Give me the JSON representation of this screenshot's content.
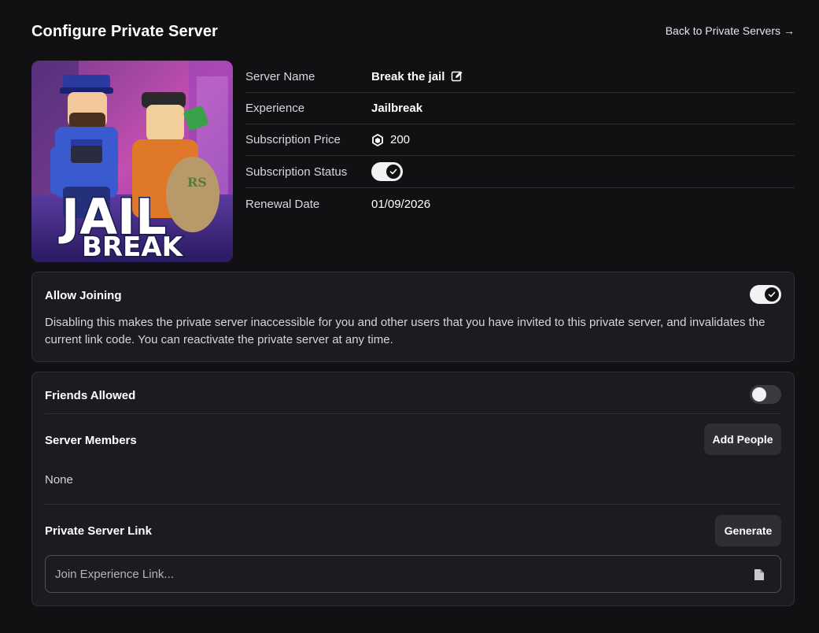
{
  "header": {
    "title": "Configure Private Server",
    "back_link": "Back to Private Servers",
    "back_arrow": "→"
  },
  "thumbnail": {
    "logo_top": "JAIL",
    "logo_bottom": "BREAK",
    "bag_text": "RS"
  },
  "details": {
    "server_name_label": "Server Name",
    "server_name_value": "Break the jail",
    "experience_label": "Experience",
    "experience_value": "Jailbreak",
    "price_label": "Subscription Price",
    "price_value": "200",
    "status_label": "Subscription Status",
    "status_on": true,
    "renewal_label": "Renewal Date",
    "renewal_value": "01/09/2026"
  },
  "allow_joining": {
    "title": "Allow Joining",
    "enabled": true,
    "description": "Disabling this makes the private server inaccessible for you and other users that you have invited to this private server, and invalidates the current link code. You can reactivate the private server at any time."
  },
  "access": {
    "friends_label": "Friends Allowed",
    "friends_enabled": false,
    "members_label": "Server Members",
    "add_people_label": "Add People",
    "members_empty": "None",
    "link_label": "Private Server Link",
    "generate_label": "Generate",
    "link_placeholder": "Join Experience Link..."
  },
  "icons": {
    "edit": "edit-icon",
    "robux": "robux-icon",
    "check": "check-icon",
    "copy": "copy-icon"
  }
}
